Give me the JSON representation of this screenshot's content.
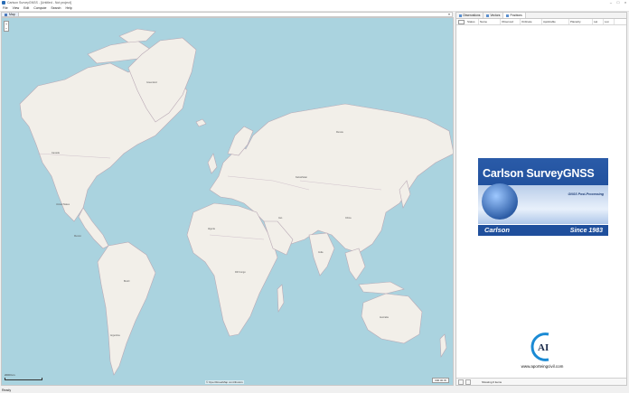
{
  "window": {
    "title": "Carlson SurveyGNSS - [Untitled - Not project]",
    "controls": [
      "–",
      "□",
      "×"
    ]
  },
  "menu": [
    "File",
    "View",
    "Edit",
    "Compute",
    "Search",
    "Help"
  ],
  "map_panel": {
    "tab_label": "Map",
    "zoom_in": "+",
    "zoom_out": "−",
    "scale_label": "2000 km",
    "attribution": "© OpenStreetMap contributors",
    "coord_readout": "000.00 W"
  },
  "map_labels": {
    "united_states": "United States",
    "canada": "Canada",
    "greenland": "Greenland",
    "brazil": "Brazil",
    "russia": "Russia",
    "china": "China",
    "india": "India",
    "australia": "Australia",
    "algeria": "Algeria",
    "congo": "DR Congo",
    "argentina": "Argentina",
    "mexico": "Mexico",
    "kazakhstan": "Kazakhstan",
    "iran": "Iran"
  },
  "right_panel": {
    "tabs": [
      "Observations",
      "Vectors",
      "Positions"
    ],
    "columns": [
      "Status",
      "Name",
      "Observed",
      "Ordinate",
      "Applicable",
      "Planarity",
      "Lat",
      "Lon"
    ],
    "status_text": "Showing 0 items"
  },
  "banner": {
    "title": "Carlson SurveyGNSS",
    "subtitle": "GNSS Post-Processing",
    "brand": "Carlson",
    "since": "Since 1983"
  },
  "logo_text": "AI",
  "website": "www.aporteingcivil.com",
  "statusbar": {
    "text": "Ready"
  },
  "colors": {
    "ocean": "#aad3df",
    "land": "#f2efe9",
    "banner_blue": "#1f4f9c"
  }
}
